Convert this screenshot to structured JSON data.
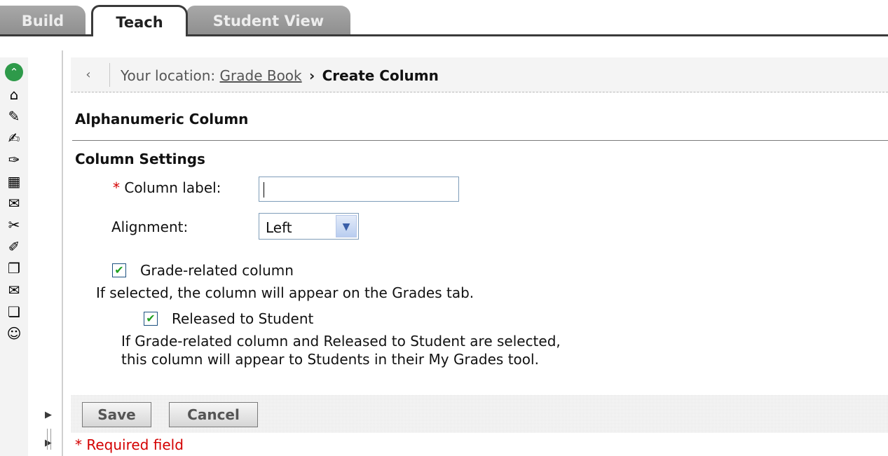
{
  "tabs": {
    "build": "Build",
    "teach": "Teach",
    "student_view": "Student View"
  },
  "rail": {
    "icons": [
      {
        "name": "collapse-up-icon",
        "glyph": "⌃"
      },
      {
        "name": "home-icon",
        "glyph": "⌂"
      },
      {
        "name": "announcements-icon",
        "glyph": "✎"
      },
      {
        "name": "assessments-icon",
        "glyph": "✍"
      },
      {
        "name": "assignments-icon",
        "glyph": "✑"
      },
      {
        "name": "calendar-icon",
        "glyph": "▦"
      },
      {
        "name": "discussions-icon",
        "glyph": "✉"
      },
      {
        "name": "pin-icon",
        "glyph": "✂"
      },
      {
        "name": "grades-icon",
        "glyph": "✐"
      },
      {
        "name": "documents-icon",
        "glyph": "❐"
      },
      {
        "name": "mail-icon",
        "glyph": "✉"
      },
      {
        "name": "files-icon",
        "glyph": "❏"
      },
      {
        "name": "roster-icon",
        "glyph": "☺"
      }
    ]
  },
  "breadcrumb": {
    "prefix": "Your location: ",
    "link": "Grade Book",
    "arrow": "›",
    "current": "Create Column"
  },
  "page": {
    "title": "Alphanumeric Column",
    "section_title": "Column Settings"
  },
  "form": {
    "required_star": "*",
    "column_label": "Column label:",
    "column_label_value": "",
    "alignment_label": "Alignment:",
    "alignment_value": "Left",
    "grade_related_label": "Grade-related column",
    "grade_related_checked": true,
    "grade_related_help": "If selected, the column will appear on the Grades tab.",
    "released_label": "Released to Student",
    "released_checked": true,
    "released_help_line1": "If Grade-related column and Released to Student are selected,",
    "released_help_line2": "this column will appear to Students in their My Grades tool."
  },
  "actions": {
    "save": "Save",
    "cancel": "Cancel"
  },
  "required_note": "* Required field"
}
